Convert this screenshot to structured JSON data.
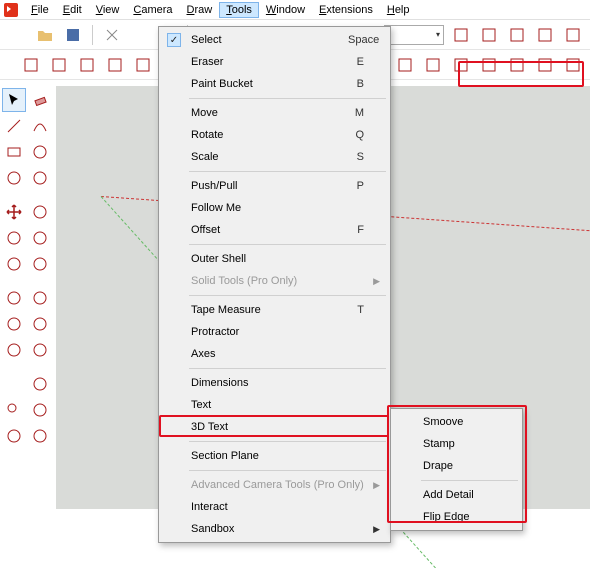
{
  "menubar": {
    "items": [
      "File",
      "Edit",
      "View",
      "Camera",
      "Draw",
      "Tools",
      "Window",
      "Extensions",
      "Help"
    ],
    "open_index": 5
  },
  "toolbar1": {
    "icons": [
      "new-file-icon",
      "open-file-icon",
      "save-icon",
      "cut-icon",
      "copy-icon",
      "paste-icon",
      "undo-icon",
      "redo-icon"
    ],
    "combo_value": "",
    "icons_right": [
      "shadow-icon",
      "vray-icon",
      "render-preset-icon",
      "render-icon",
      "render-output-icon"
    ]
  },
  "toolbar2": {
    "icons_left": [
      "make-component-icon",
      "iso-icon",
      "top-view-icon",
      "front-view-icon",
      "right-view-icon",
      "back-view-icon",
      "left-view-icon",
      "perspective-icon"
    ],
    "icons_right": [
      "sandbox-a-icon",
      "sandbox-b-icon",
      "smoove-icon",
      "stamp-icon",
      "drape-icon",
      "add-detail-icon",
      "flip-edge-icon"
    ]
  },
  "side_tools": {
    "rows": [
      [
        "select-tool-icon",
        "eraser-tool-icon"
      ],
      [
        "line-tool-icon",
        "arc-tool-icon"
      ],
      [
        "rectangle-tool-icon",
        "circle-tool-icon"
      ],
      [
        "polygon-tool-icon",
        "freehand-tool-icon"
      ],
      [
        "move-tool-icon",
        "pushpull-tool-icon"
      ],
      [
        "rotate-tool-icon",
        "followme-tool-icon"
      ],
      [
        "scale-tool-icon",
        "offset-tool-icon"
      ],
      [
        "tape-tool-icon",
        "dimension-tool-icon"
      ],
      [
        "protractor-tool-icon",
        "text-tool-icon"
      ],
      [
        "axes-tool-icon",
        "3dtext-tool-icon"
      ],
      [
        "orbit-tool-icon",
        "pan-tool-icon"
      ],
      [
        "zoom-tool-icon",
        "zoom-window-tool-icon"
      ],
      [
        "zoom-extents-tool-icon",
        "previous-view-icon"
      ]
    ],
    "selected": "select-tool-icon"
  },
  "tools_menu": {
    "groups": [
      [
        {
          "label": "Select",
          "shortcut": "Space",
          "checked": true
        },
        {
          "label": "Eraser",
          "shortcut": "E"
        },
        {
          "label": "Paint Bucket",
          "shortcut": "B"
        }
      ],
      [
        {
          "label": "Move",
          "shortcut": "M"
        },
        {
          "label": "Rotate",
          "shortcut": "Q"
        },
        {
          "label": "Scale",
          "shortcut": "S"
        }
      ],
      [
        {
          "label": "Push/Pull",
          "shortcut": "P"
        },
        {
          "label": "Follow Me"
        },
        {
          "label": "Offset",
          "shortcut": "F"
        }
      ],
      [
        {
          "label": "Outer Shell"
        },
        {
          "label": "Solid Tools (Pro Only)",
          "disabled": true,
          "submenu": true
        }
      ],
      [
        {
          "label": "Tape Measure",
          "shortcut": "T"
        },
        {
          "label": "Protractor"
        },
        {
          "label": "Axes"
        }
      ],
      [
        {
          "label": "Dimensions"
        },
        {
          "label": "Text"
        },
        {
          "label": "3D Text"
        }
      ],
      [
        {
          "label": "Section Plane"
        }
      ],
      [
        {
          "label": "Advanced Camera Tools (Pro Only)",
          "disabled": true,
          "submenu": true
        },
        {
          "label": "Interact"
        },
        {
          "label": "Sandbox",
          "submenu": true,
          "highlight": true
        }
      ]
    ]
  },
  "sandbox_submenu": {
    "groups": [
      [
        {
          "label": "Smoove"
        },
        {
          "label": "Stamp"
        },
        {
          "label": "Drape"
        }
      ],
      [
        {
          "label": "Add Detail"
        },
        {
          "label": "Flip Edge"
        }
      ]
    ]
  },
  "colors": {
    "highlight": "#e01020",
    "menu_hover": "#cde8ff"
  }
}
